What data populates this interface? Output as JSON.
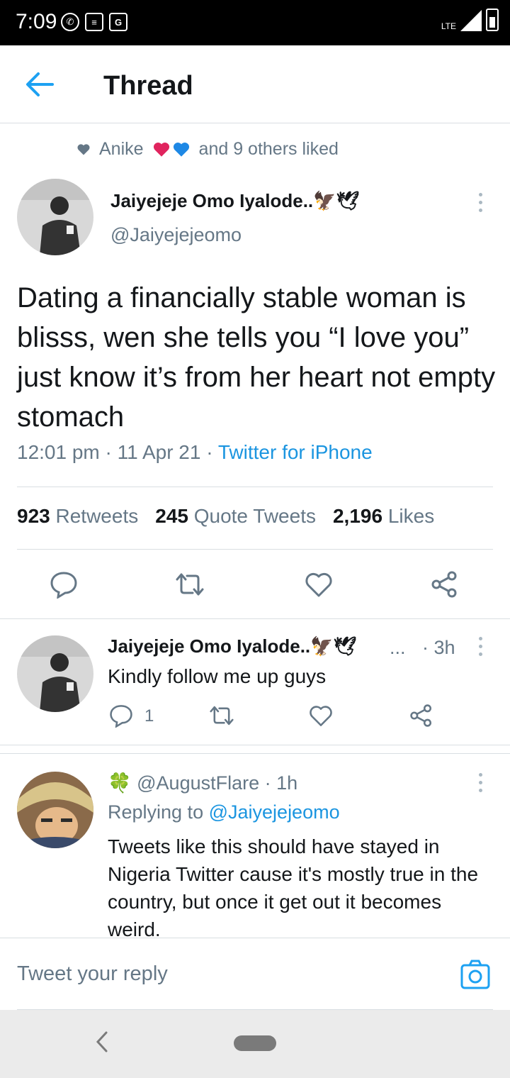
{
  "status_bar": {
    "time": "7:09",
    "network": "LTE"
  },
  "header": {
    "title": "Thread"
  },
  "social_context": {
    "name": "Anike",
    "rest": "and 9 others liked"
  },
  "main_tweet": {
    "author_name": "Jaiyejeje Omo Iyalode..",
    "author_emoji": "🦅🕊",
    "handle": "@Jaiyejejeomo",
    "text": "Dating a financially stable woman is blisss, wen she tells you “I love you” just know it’s from her heart not empty stomach",
    "time": "12:01 pm",
    "date": "11 Apr 21",
    "source": "Twitter for iPhone",
    "retweets": "923",
    "retweets_label": "Retweets",
    "quotes": "245",
    "quotes_label": "Quote Tweets",
    "likes": "2,196",
    "likes_label": "Likes"
  },
  "reply1": {
    "author_name": "Jaiyejeje Omo Iyalode..",
    "author_emoji": "🦅🕊",
    "ellipsis": "...",
    "age": "· 3h",
    "text": "Kindly follow me up guys",
    "reply_count": "1"
  },
  "reply2": {
    "emoji": "🍀",
    "handle": "@AugustFlare",
    "age": "· 1h",
    "replying_prefix": "Replying to",
    "replying_handle": "@Jaiyejejeomo",
    "text": "Tweets like this should have stayed in Nigeria Twitter cause it's mostly true in the country, but once it get out it becomes weird."
  },
  "reply_box": {
    "placeholder": "Tweet your reply"
  },
  "colors": {
    "accent": "#1da1f2",
    "muted": "#657786",
    "like_red": "#e0245e",
    "heart_blue": "#1e88e5"
  }
}
